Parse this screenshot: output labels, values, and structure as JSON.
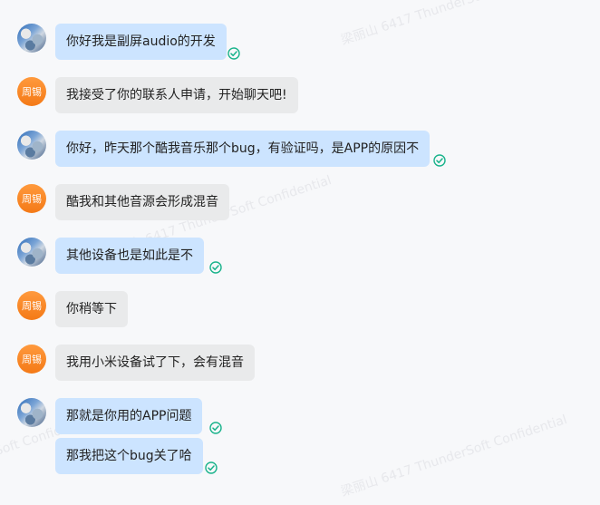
{
  "watermark_texts": [
    "梁丽山 6417 ThunderSoft Confidential"
  ],
  "contacts": {
    "other_name_avatar": "周锡"
  },
  "colors": {
    "my_bubble": "#cce4ff",
    "other_bubble": "#e9eaeb",
    "check": "#19b38b",
    "avatar_orange": "#f47a17"
  },
  "messages": [
    {
      "sender": "me",
      "text": "你好我是副屏audio的开发",
      "read": true
    },
    {
      "sender": "other",
      "text": "我接受了你的联系人申请，开始聊天吧!"
    },
    {
      "sender": "me",
      "text": "你好，昨天那个酷我音乐那个bug，有验证吗，是APP的原因不",
      "read": true
    },
    {
      "sender": "other",
      "text": "酷我和其他音源会形成混音"
    },
    {
      "sender": "me",
      "text": "其他设备也是如此是不",
      "read": true
    },
    {
      "sender": "other",
      "text": "你稍等下"
    },
    {
      "sender": "other",
      "text": "我用小米设备试了下，会有混音"
    },
    {
      "sender": "me",
      "text": "那就是你用的APP问题",
      "read": true
    },
    {
      "sender": "me",
      "text": "那我把这个bug关了哈",
      "read": true
    }
  ]
}
